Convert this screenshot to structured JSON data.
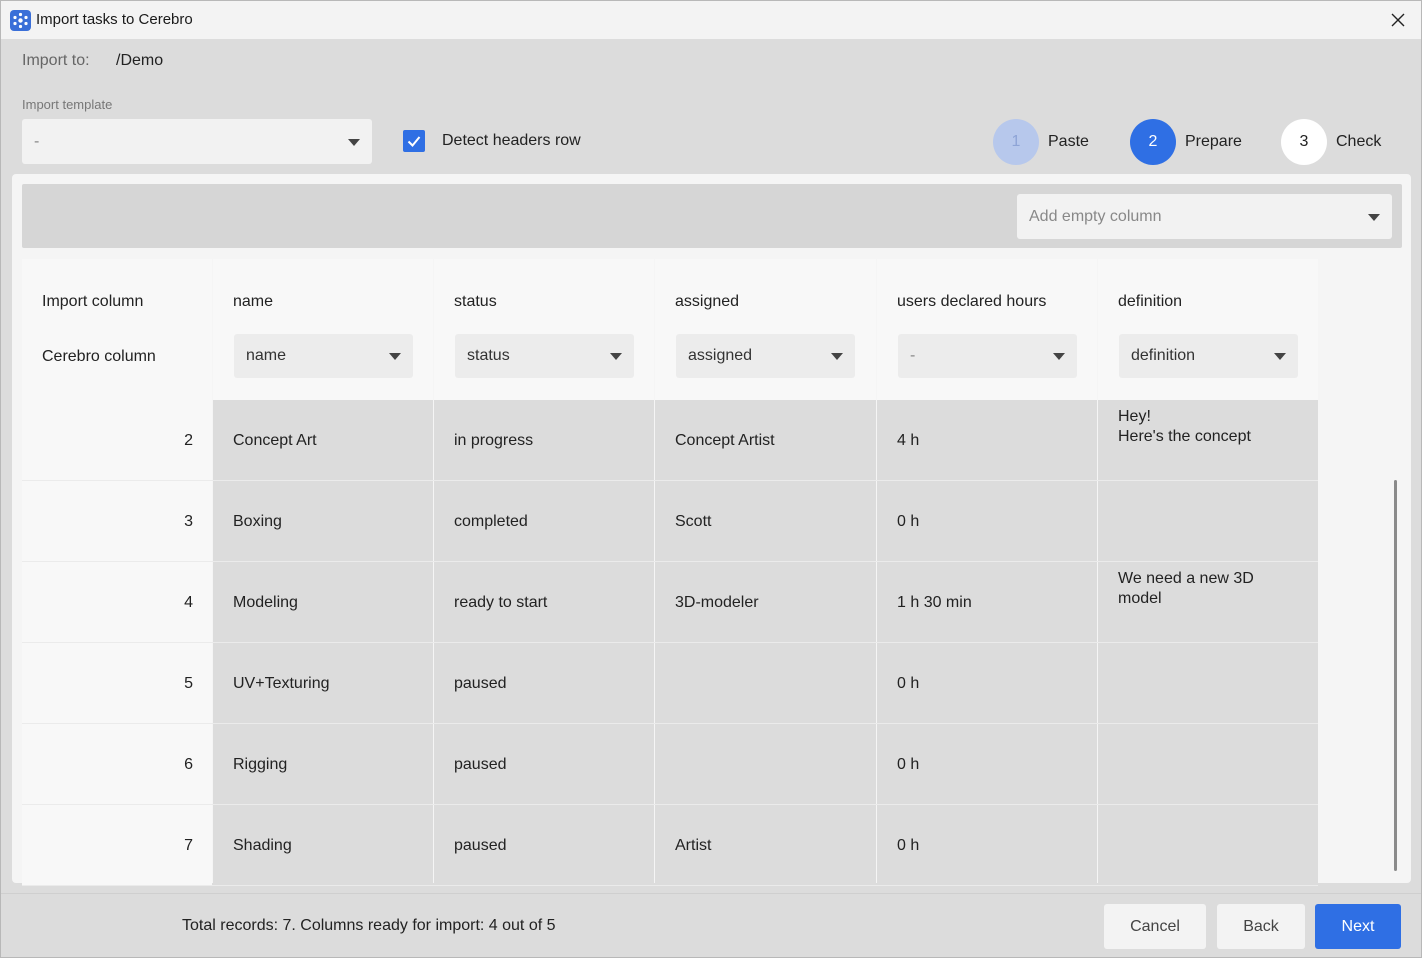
{
  "window": {
    "title": "Import tasks to Cerebro",
    "icon": "cerebro-app-icon",
    "close_icon": "close-icon"
  },
  "import_to": {
    "label": "Import to:",
    "value": "/Demo"
  },
  "template": {
    "label": "Import template",
    "value": "-"
  },
  "detect_headers": {
    "label": "Detect headers row",
    "checked": true
  },
  "steps": [
    {
      "number": "1",
      "label": "Paste",
      "state": "done"
    },
    {
      "number": "2",
      "label": "Prepare",
      "state": "active"
    },
    {
      "number": "3",
      "label": "Check",
      "state": "pending"
    }
  ],
  "toolbar": {
    "add_column_placeholder": "Add empty column"
  },
  "grid": {
    "row_header": {
      "import_label": "Import column",
      "cerebro_label": "Cerebro column"
    },
    "columns": [
      {
        "import": "name",
        "cerebro": "name"
      },
      {
        "import": "status",
        "cerebro": "status"
      },
      {
        "import": "assigned",
        "cerebro": "assigned"
      },
      {
        "import": "users declared hours",
        "cerebro": "-"
      },
      {
        "import": "definition",
        "cerebro": "definition"
      }
    ],
    "rows": [
      {
        "num": "2",
        "cells": [
          "Concept Art",
          "in progress",
          "Concept Artist",
          "4 h",
          "Hey!\nHere's the concept"
        ]
      },
      {
        "num": "3",
        "cells": [
          "Boxing",
          "completed",
          "Scott",
          "0 h",
          ""
        ]
      },
      {
        "num": "4",
        "cells": [
          "Modeling",
          "ready to start",
          "3D-modeler",
          "1 h 30 min",
          "We need a new 3D\nmodel"
        ]
      },
      {
        "num": "5",
        "cells": [
          "UV+Texturing",
          "paused",
          "",
          "0 h",
          ""
        ]
      },
      {
        "num": "6",
        "cells": [
          "Rigging",
          "paused",
          "",
          "0 h",
          ""
        ]
      },
      {
        "num": "7",
        "cells": [
          "Shading",
          "paused",
          "Artist",
          "0 h",
          ""
        ]
      }
    ]
  },
  "footer": {
    "summary": "Total records: 7. Columns ready for import: 4 out of 5",
    "cancel_label": "Cancel",
    "back_label": "Back",
    "next_label": "Next"
  },
  "colors": {
    "accent": "#2f6fe4",
    "step_done": "#b7c8ec",
    "step_pending": "#ffffff"
  }
}
